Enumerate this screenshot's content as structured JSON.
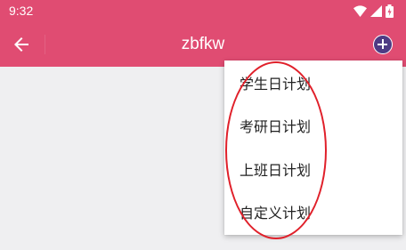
{
  "status_bar": {
    "time": "9:32",
    "icons": [
      "wifi-icon",
      "signal-icon",
      "battery-icon"
    ]
  },
  "app_bar": {
    "title": "zbfkw",
    "back_icon": "arrow-left-icon",
    "add_icon": "plus-circle-icon",
    "background_color": "#e04c72",
    "add_button_color": "#4e3b84"
  },
  "menu": {
    "items": [
      {
        "label": "学生日计划"
      },
      {
        "label": "考研日计划"
      },
      {
        "label": "上班日计划"
      },
      {
        "label": "自定义计划"
      }
    ]
  },
  "annotation": {
    "shape": "ellipse",
    "color": "#e0202a"
  }
}
